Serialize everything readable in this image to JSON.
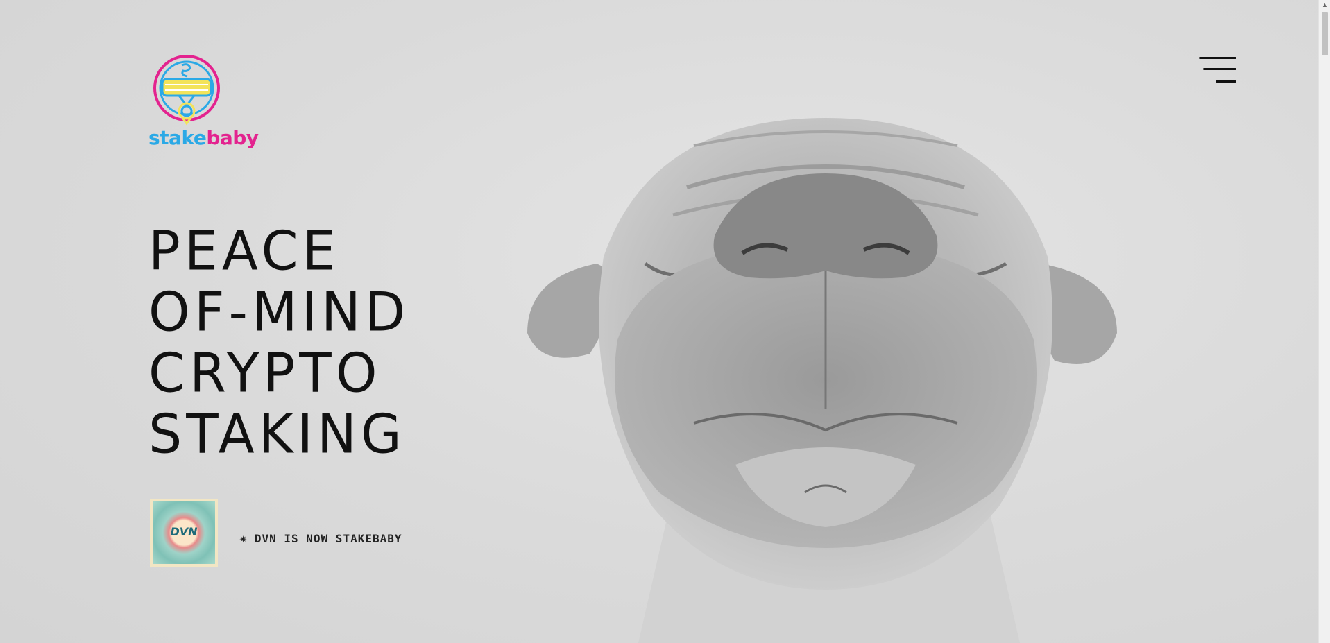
{
  "brand": {
    "part1": "stake",
    "part2": "baby",
    "color1": "#2ba9e6",
    "color2": "#e3238f",
    "accent_yellow": "#f3e35a"
  },
  "header": {
    "menu_icon": "hamburger-menu-icon"
  },
  "hero": {
    "headline_lines": [
      "PEACE",
      "OF-MIND",
      "CRYPTO",
      "STAKING"
    ]
  },
  "announcement": {
    "badge_text": "DVN",
    "star_glyph": "✷",
    "text": "DVN IS NOW STAKEBABY"
  },
  "scrollbar": {
    "up_icon": "scroll-up-arrow-icon"
  }
}
